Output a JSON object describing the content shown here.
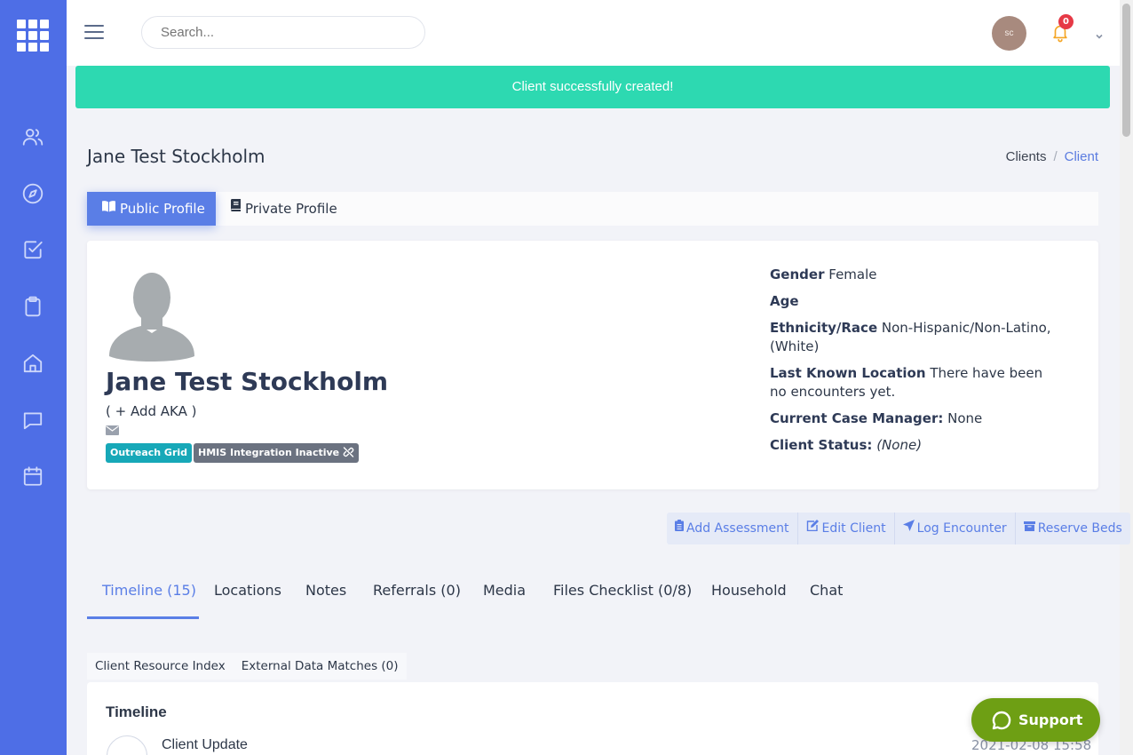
{
  "topbar": {
    "search_placeholder": "Search...",
    "user_initials": "sc",
    "notification_count": "0"
  },
  "alert": {
    "message": "Client successfully created!"
  },
  "page": {
    "title": "Jane Test Stockholm"
  },
  "breadcrumb": {
    "items": [
      "Clients",
      "Client"
    ],
    "separator": "/"
  },
  "profile_tabs": {
    "public": "Public Profile",
    "private": "Private Profile"
  },
  "client": {
    "name": "Jane Test Stockholm",
    "add_aka": "( + Add AKA )",
    "tags": [
      "Outreach Grid",
      "HMIS Integration Inactive"
    ],
    "fields": {
      "gender_label": "Gender",
      "gender_value": "Female",
      "age_label": "Age",
      "ethnicity_label": "Ethnicity/Race",
      "ethnicity_value": "Non-Hispanic/Non-Latino, (White)",
      "location_label": "Last Known Location",
      "location_value": "There have been no encounters yet.",
      "case_manager_label": "Current Case Manager:",
      "case_manager_value": "None",
      "status_label": "Client Status:",
      "status_value": "(None)"
    }
  },
  "actions": {
    "add_assessment": "Add Assessment",
    "edit_client": "Edit Client",
    "log_encounter": "Log Encounter",
    "reserve_beds": "Reserve Beds"
  },
  "main_tabs": [
    "Timeline (15)",
    "Locations",
    "Notes",
    "Referrals (0)",
    "Media",
    "Files Checklist (0/8)",
    "Household",
    "Chat"
  ],
  "sub_tabs": [
    "Client Resource Index",
    "External Data Matches (0)"
  ],
  "timeline": {
    "title": "Timeline",
    "item_title": "Client Update",
    "item_date": "2021-02-08 15:58"
  },
  "support": {
    "label": "Support"
  },
  "colors": {
    "sidebar": "#4e6ee6",
    "accent": "#5a7ee6",
    "alert_success": "#2dd9b1",
    "support_button": "#6e9f14",
    "notification_badge": "#e63946",
    "tag_outreach": "#17a8b8",
    "tag_hmis": "#6b7280"
  },
  "icons": {
    "sidebar": [
      "users-icon",
      "compass-icon",
      "checkbox-icon",
      "clipboard-icon",
      "home-icon",
      "chat-icon",
      "calendar-icon"
    ]
  }
}
